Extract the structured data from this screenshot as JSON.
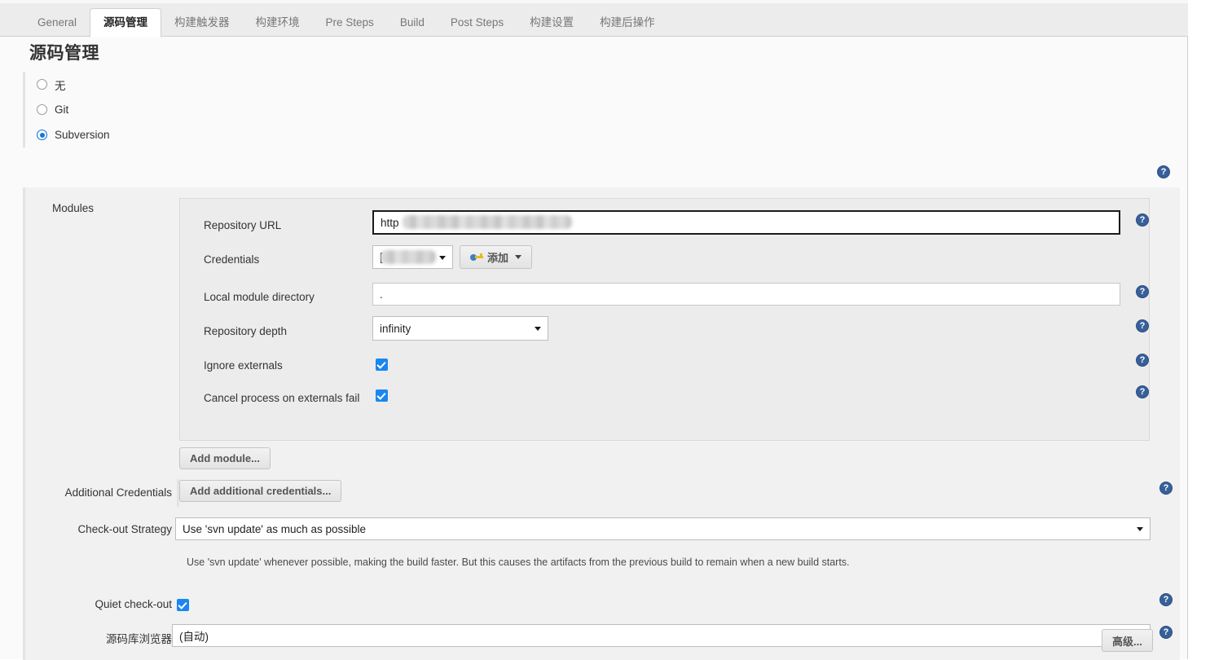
{
  "tabs": [
    {
      "label": "General",
      "active": false
    },
    {
      "label": "源码管理",
      "active": true
    },
    {
      "label": "构建触发器",
      "active": false
    },
    {
      "label": "构建环境",
      "active": false
    },
    {
      "label": "Pre Steps",
      "active": false
    },
    {
      "label": "Build",
      "active": false
    },
    {
      "label": "Post Steps",
      "active": false
    },
    {
      "label": "构建设置",
      "active": false
    },
    {
      "label": "构建后操作",
      "active": false
    }
  ],
  "page": {
    "title": "源码管理"
  },
  "scm": {
    "options": [
      {
        "label": "无",
        "selected": false
      },
      {
        "label": "Git",
        "selected": false
      },
      {
        "label": "Subversion",
        "selected": true
      }
    ]
  },
  "subversion": {
    "modules_label": "Modules",
    "fields": {
      "repository_url": {
        "label": "Repository URL",
        "value": "http",
        "redacted": true
      },
      "credentials": {
        "label": "Credentials",
        "value": "[",
        "redacted": true,
        "add_button": "添加",
        "add_icon": "key-icon"
      },
      "local_module_directory": {
        "label": "Local module directory",
        "value": "."
      },
      "repository_depth": {
        "label": "Repository depth",
        "value": "infinity"
      },
      "ignore_externals": {
        "label": "Ignore externals",
        "checked": true
      },
      "cancel_process_on_externals_fail": {
        "label": "Cancel process on externals fail",
        "checked": true
      }
    },
    "add_module_button": "Add module..."
  },
  "additional_credentials": {
    "label": "Additional Credentials",
    "button": "Add additional credentials..."
  },
  "checkout_strategy": {
    "label": "Check-out Strategy",
    "value": "Use 'svn update' as much as possible",
    "description": "Use 'svn update' whenever possible, making the build faster. But this causes the artifacts from the previous build to remain when a new build starts."
  },
  "quiet_checkout": {
    "label": "Quiet check-out",
    "checked": true
  },
  "repository_browser": {
    "label": "源码库浏览器",
    "value": "(自动)"
  },
  "advanced_button": {
    "label": "高级..."
  },
  "icons": {
    "help": "?"
  },
  "colors": {
    "accent_blue": "#1b86f0",
    "help_blue": "#37609b",
    "panel_gray": "#f1f1f1",
    "tabbar_gray": "#ececec"
  }
}
